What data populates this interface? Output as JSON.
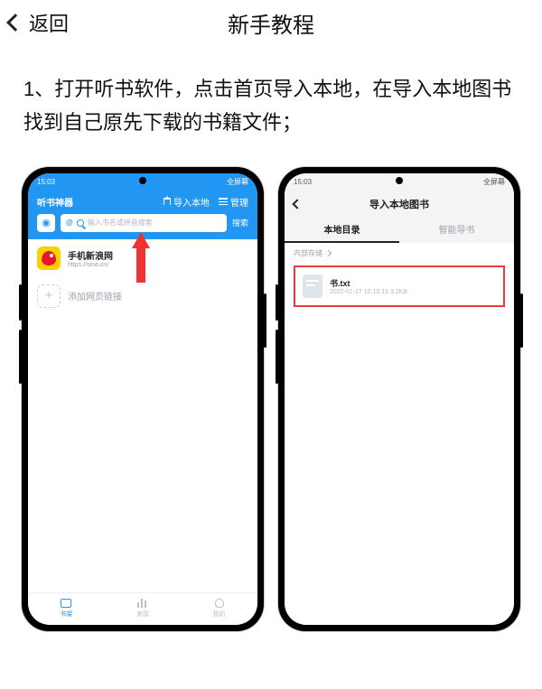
{
  "topbar": {
    "back_label": "返回",
    "title": "新手教程"
  },
  "instruction": "1、打开听书软件，点击首页导入本地，在导入本地图书找到自己原先下载的书籍文件；",
  "left_phone": {
    "status_time": "15:03",
    "status_right": "全屏幕",
    "header_title": "听书神器",
    "import_label": "导入本地",
    "manage_label": "管理",
    "search_placeholder": "输入书名或拼音搜索",
    "search_button": "搜索",
    "item1_title": "手机新浪网",
    "item1_sub": "https://sina.cn/",
    "item2_label": "添加网页链接",
    "nav": {
      "a": "书架",
      "b": "发现",
      "c": "我的"
    }
  },
  "right_phone": {
    "status_time": "15:03",
    "status_right": "全屏幕",
    "header_title": "导入本地图书",
    "tab_active": "本地目录",
    "tab_inactive": "智能导书",
    "path_label": "内部存储",
    "file_name": "书.txt",
    "file_meta": "2022-01-17 10:15:15   3.2KB"
  }
}
